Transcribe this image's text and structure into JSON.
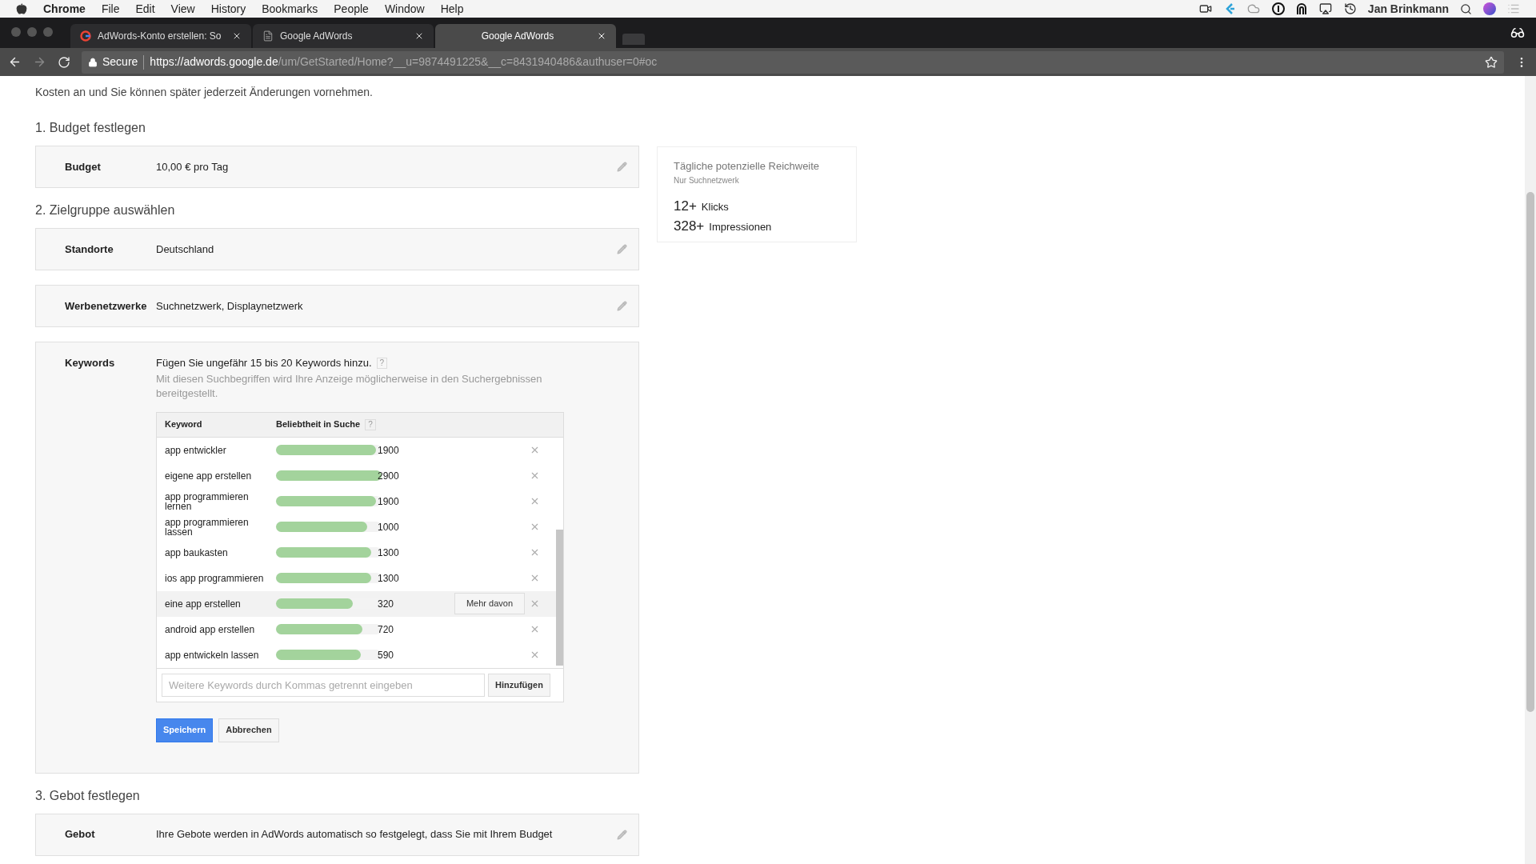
{
  "menu_bar": {
    "app": "Chrome",
    "menus": [
      "File",
      "Edit",
      "View",
      "History",
      "Bookmarks",
      "People",
      "Window",
      "Help"
    ],
    "user": "Jan Brinkmann"
  },
  "tabs": [
    {
      "title": "AdWords-Konto erstellen: So",
      "selected": false
    },
    {
      "title": "Google AdWords",
      "selected": false
    },
    {
      "title": "Google AdWords",
      "selected": true
    }
  ],
  "address_bar": {
    "secure_label": "Secure",
    "url_host": "https://adwords.google.de",
    "url_path": "/um/GetStarted/Home?__u=9874491225&__c=8431940486&authuser=0#oc"
  },
  "intro": "Kosten an und Sie können später jederzeit Änderungen vornehmen.",
  "sections": [
    {
      "heading": "1. Budget festlegen",
      "cards": [
        {
          "kind": "summary",
          "label": "Budget",
          "value": "10,00 € pro Tag"
        }
      ]
    },
    {
      "heading": "2. Zielgruppe auswählen",
      "cards": [
        {
          "kind": "summary",
          "label": "Standorte",
          "value": "Deutschland"
        },
        {
          "kind": "summary",
          "label": "Werbenetzwerke",
          "value": "Suchnetzwerk, Displaynetzwerk"
        },
        {
          "kind": "keywords",
          "label": "Keywords"
        }
      ]
    },
    {
      "heading": "3. Gebot festlegen",
      "cards": [
        {
          "kind": "summary",
          "label": "Gebot",
          "value": "Ihre Gebote werden in AdWords automatisch so festgelegt, dass Sie mit Ihrem Budget"
        }
      ]
    }
  ],
  "keywords": {
    "instruction": "Fügen Sie ungefähr 15 bis 20 Keywords hinzu.",
    "help": "?",
    "description": "Mit diesen Suchbegriffen wird Ihre Anzeige möglicherweise in den Suchergebnissen bereitgestellt.",
    "columns": [
      "Keyword",
      "Beliebtheit in Suche"
    ],
    "column_help": "?",
    "rows": [
      {
        "keyword": "app entwickler",
        "level": 0.95,
        "count": "1900",
        "highlighted": false
      },
      {
        "keyword": "eigene app erstellen",
        "level": 1.0,
        "count": "2900",
        "highlighted": false
      },
      {
        "keyword": "app programmieren lernen",
        "level": 0.95,
        "count": "1900",
        "highlighted": false
      },
      {
        "keyword": "app programmieren lassen",
        "level": 0.86,
        "count": "1000",
        "highlighted": false
      },
      {
        "keyword": "app baukasten",
        "level": 0.9,
        "count": "1300",
        "highlighted": false
      },
      {
        "keyword": "ios app programmieren",
        "level": 0.9,
        "count": "1300",
        "highlighted": false
      },
      {
        "keyword": "eine app erstellen",
        "level": 0.73,
        "count": "320",
        "highlighted": true,
        "action": "Mehr davon"
      },
      {
        "keyword": "android app erstellen",
        "level": 0.82,
        "count": "720",
        "highlighted": false
      },
      {
        "keyword": "app entwickeln lassen",
        "level": 0.8,
        "count": "590",
        "highlighted": false
      }
    ],
    "input_placeholder": "Weitere Keywords durch Kommas getrennt eingeben",
    "add_button": "Hinzufügen",
    "save_button": "Speichern",
    "cancel_button": "Abbrechen"
  },
  "reach": {
    "title": "Tägliche potenzielle Reichweite",
    "subtitle": "Nur Suchnetzwerk",
    "stats": [
      {
        "value": "12+",
        "label": "Klicks"
      },
      {
        "value": "328+",
        "label": "Impressionen"
      }
    ]
  }
}
